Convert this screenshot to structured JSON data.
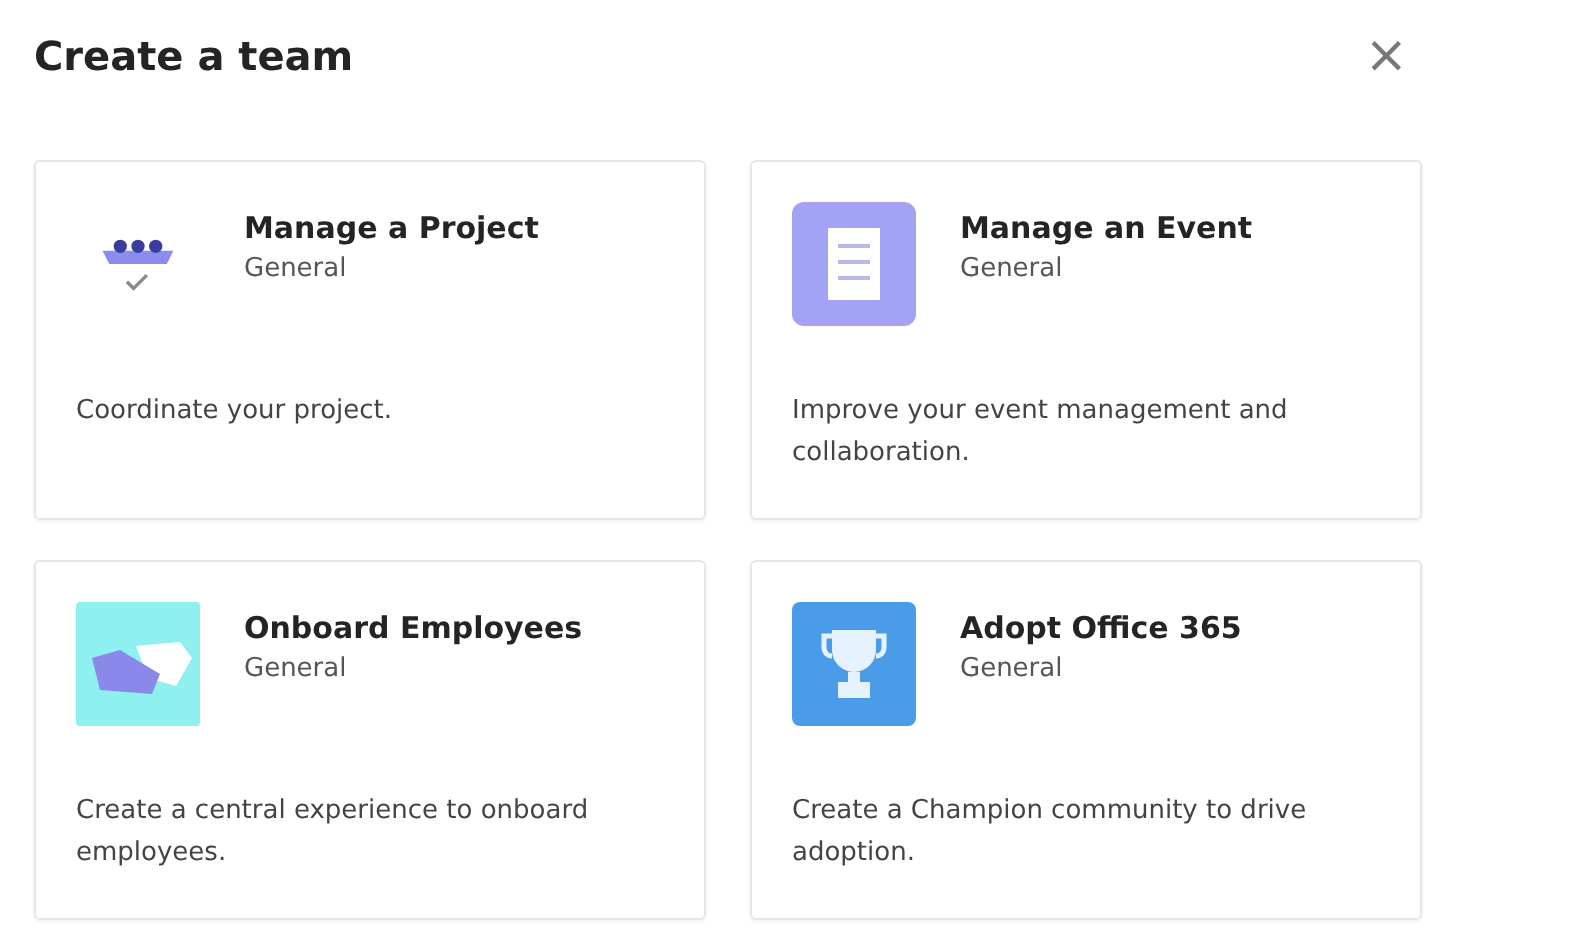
{
  "dialog": {
    "title": "Create a team",
    "close": "×"
  },
  "templates": [
    {
      "kind": "project",
      "name": "Manage a Project",
      "category": "General",
      "description": "Coordinate your project."
    },
    {
      "kind": "event",
      "name": "Manage an Event",
      "category": "General",
      "description": "Improve your event management and collaboration."
    },
    {
      "kind": "onboard",
      "name": "Onboard Employees",
      "category": "General",
      "description": "Create a central experience to onboard employees."
    },
    {
      "kind": "office",
      "name": "Adopt Office 365",
      "category": "General",
      "description": "Create a Champion community to drive adoption."
    }
  ]
}
